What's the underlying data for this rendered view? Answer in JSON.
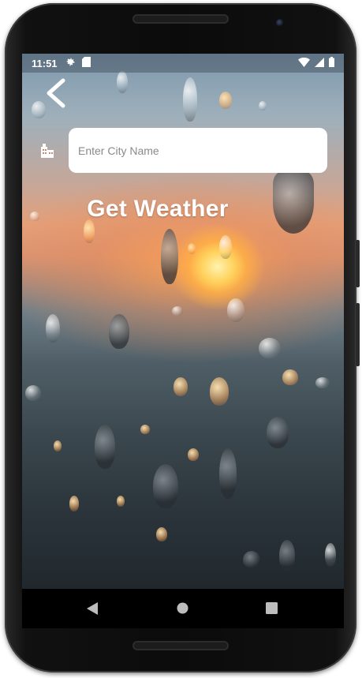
{
  "status_bar": {
    "time": "11:51",
    "left_icons": [
      "gear-icon",
      "sd-card-icon"
    ],
    "right_icons": [
      "wifi-icon",
      "signal-icon",
      "battery-icon"
    ]
  },
  "header": {
    "back_icon": "chevron-left-icon"
  },
  "search": {
    "icon": "city-icon",
    "placeholder": "Enter City Name",
    "value": ""
  },
  "actions": {
    "get_weather_label": "Get Weather"
  },
  "nav_bar": {
    "buttons": [
      "back-triangle-icon",
      "home-circle-icon",
      "recents-square-icon"
    ]
  },
  "colors": {
    "text_primary": "#ffffff",
    "input_background": "#ffffff",
    "placeholder": "#8a8a8a"
  }
}
